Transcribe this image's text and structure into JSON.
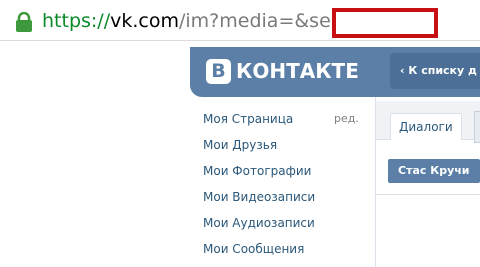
{
  "browser": {
    "url_scheme": "https://",
    "url_host": "vk.com",
    "url_rest": "/im?media=&sel=",
    "redaction_color": "#c80f14"
  },
  "header": {
    "logo_letter": "В",
    "logo_text": "КОНТАКТЕ",
    "back_link": "К списку д",
    "color": "#5b7fa6"
  },
  "menu": {
    "edit": "ред.",
    "items": [
      {
        "label": "Моя Страница"
      },
      {
        "label": "Мои Друзья"
      },
      {
        "label": "Мои Фотографии"
      },
      {
        "label": "Мои Видеозаписи"
      },
      {
        "label": "Мои Аудиозаписи"
      },
      {
        "label": "Мои Сообщения"
      }
    ]
  },
  "tabs": [
    {
      "label": "Диалоги"
    }
  ],
  "contact": {
    "name": "Стас Кручи"
  }
}
